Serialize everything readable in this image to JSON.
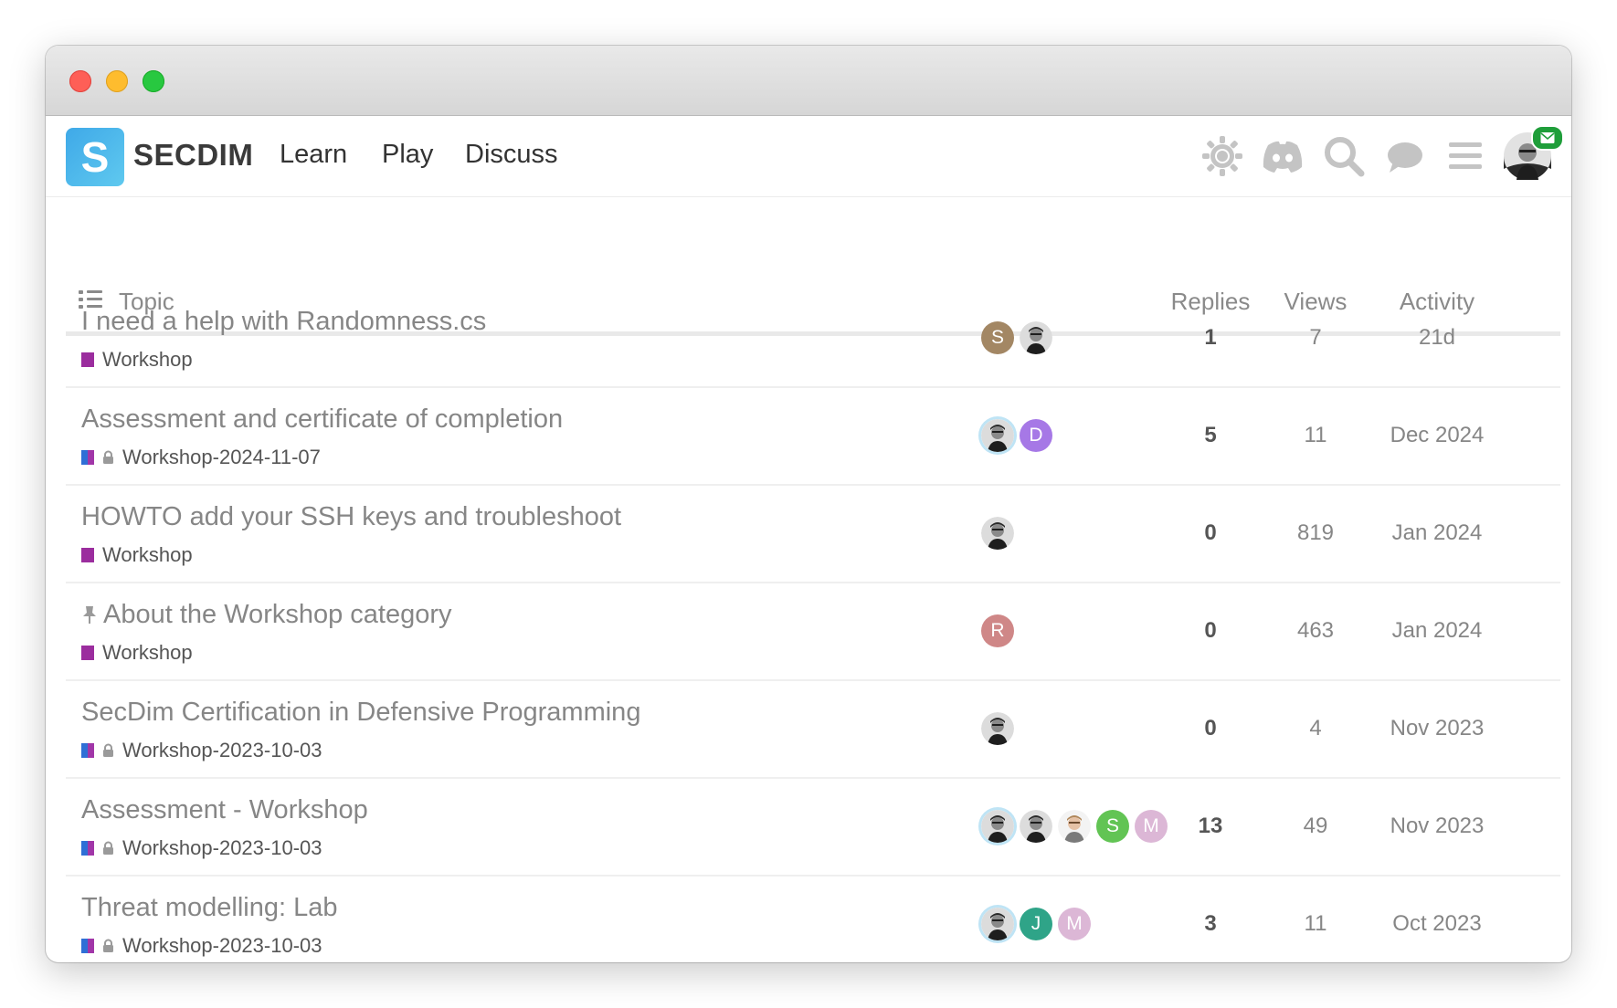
{
  "brand": {
    "letter": "S",
    "name": "SECDIM"
  },
  "nav": [
    {
      "label": "Learn"
    },
    {
      "label": "Play"
    },
    {
      "label": "Discuss"
    }
  ],
  "header_icons": [
    "theme-toggle-icon",
    "discord-icon",
    "search-icon",
    "chat-icon",
    "menu-icon"
  ],
  "columns": {
    "topic": "Topic",
    "replies": "Replies",
    "views": "Views",
    "activity": "Activity"
  },
  "colors": {
    "workshop": "#9b2d9e",
    "dated_workshop_a": "#2f6fd6",
    "dated_workshop_b": "#a136a8",
    "logo": "#3fa9e8",
    "mail_badge": "#1f9e3a"
  },
  "topics": [
    {
      "title": "I need a help with Randomness.cs",
      "category": "Workshop",
      "locked": false,
      "pinned": false,
      "posters": [
        {
          "letter": "S",
          "color": "#a38764"
        },
        {
          "photo": true
        }
      ],
      "replies": "1",
      "views": "7",
      "activity": "21d"
    },
    {
      "title": "Assessment and certificate of completion",
      "category": "Workshop-2024-11-07",
      "locked": true,
      "pinned": false,
      "posters": [
        {
          "photo": true,
          "ring": true
        },
        {
          "letter": "D",
          "color": "#a678e6"
        }
      ],
      "replies": "5",
      "views": "11",
      "activity": "Dec 2024"
    },
    {
      "title": "HOWTO add your SSH keys and troubleshoot",
      "category": "Workshop",
      "locked": false,
      "pinned": false,
      "posters": [
        {
          "photo": true
        }
      ],
      "replies": "0",
      "views": "819",
      "activity": "Jan 2024"
    },
    {
      "title": "About the Workshop category",
      "category": "Workshop",
      "locked": false,
      "pinned": true,
      "posters": [
        {
          "letter": "R",
          "color": "#cf8787"
        }
      ],
      "replies": "0",
      "views": "463",
      "activity": "Jan 2024"
    },
    {
      "title": "SecDim Certification in Defensive Programming",
      "category": "Workshop-2023-10-03",
      "locked": true,
      "pinned": false,
      "posters": [
        {
          "photo": true
        }
      ],
      "replies": "0",
      "views": "4",
      "activity": "Nov 2023"
    },
    {
      "title": "Assessment - Workshop",
      "category": "Workshop-2023-10-03",
      "locked": true,
      "pinned": false,
      "posters": [
        {
          "photo": true,
          "ring": true
        },
        {
          "photo": true
        },
        {
          "photo": true,
          "light": true
        },
        {
          "letter": "S",
          "color": "#62c454"
        },
        {
          "letter": "M",
          "color": "#dcb7d6"
        }
      ],
      "replies": "13",
      "views": "49",
      "activity": "Nov 2023"
    },
    {
      "title": "Threat modelling: Lab",
      "category": "Workshop-2023-10-03",
      "locked": true,
      "pinned": false,
      "posters": [
        {
          "photo": true,
          "ring": true
        },
        {
          "letter": "J",
          "color": "#2fa488"
        },
        {
          "letter": "M",
          "color": "#dcb7d6"
        }
      ],
      "replies": "3",
      "views": "11",
      "activity": "Oct 2023"
    }
  ]
}
